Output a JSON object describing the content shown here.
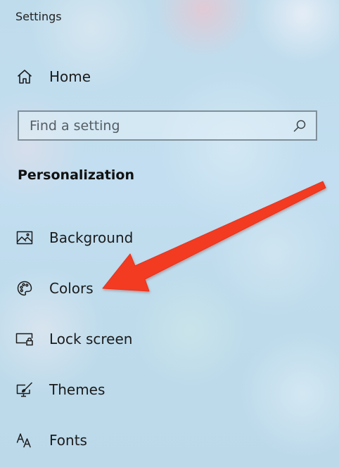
{
  "window": {
    "title": "Settings"
  },
  "nav": {
    "home": {
      "label": "Home",
      "icon": "home-icon"
    }
  },
  "search": {
    "placeholder": "Find a setting",
    "value": "",
    "icon": "search-icon"
  },
  "section": {
    "heading": "Personalization",
    "items": [
      {
        "label": "Background",
        "icon": "picture-icon"
      },
      {
        "label": "Colors",
        "icon": "palette-icon"
      },
      {
        "label": "Lock screen",
        "icon": "lock-screen-icon"
      },
      {
        "label": "Themes",
        "icon": "themes-brush-icon"
      },
      {
        "label": "Fonts",
        "icon": "fonts-icon"
      }
    ]
  },
  "annotation": {
    "arrow_color": "#f33b23",
    "points_to": "Colors"
  }
}
